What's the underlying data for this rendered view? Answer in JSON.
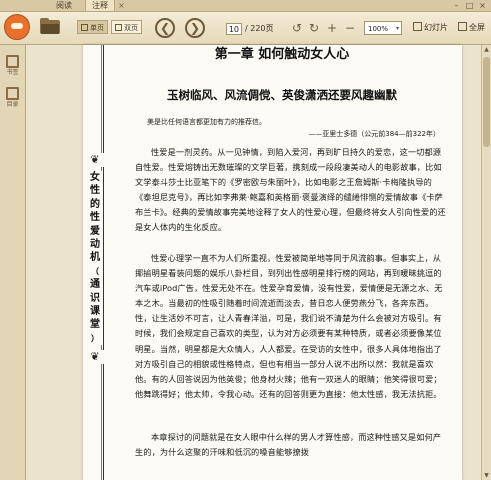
{
  "tabs": [
    {
      "label": "阅读"
    },
    {
      "label": "注释"
    }
  ],
  "tab_close": "×",
  "window_buttons": [
    "–",
    "□",
    "×"
  ],
  "toolbar": {
    "single_label": "单页",
    "double_label": "双页",
    "prev_glyph": "❮",
    "next_glyph": "❯",
    "page_current": "10",
    "page_total": "/ 220页",
    "zoom_value": "100%",
    "zoom_arrow": "▾",
    "slideshow_label": "幻灯片",
    "fullscreen_label": "全屏"
  },
  "sidebar": {
    "items": [
      {
        "label": "书签"
      },
      {
        "label": "目录"
      }
    ]
  },
  "page": {
    "vertical_title": [
      "女",
      "性",
      "的",
      "性",
      "爱",
      "动",
      "机",
      "（",
      "通",
      "识",
      "课",
      "堂",
      "）"
    ],
    "chapter_title": "第一章 如何触动女人心",
    "section_title": "玉树临风、风流倜傥、英俊潇洒还要风趣幽默",
    "quote": "美是比任何语言都更加有力的推荐信。",
    "quote_attribution": "——亚里士多德（公元前384—前322年）",
    "paragraphs": [
      "性爱是一剂灵药。从一见钟情，到陷入爱河，再到旷日持久的爱恋，这一切都源自性爱。性爱熔铸出无数璀璨的文学巨著，携刻成一段段凄美动人的电影故事，比如文学泰斗莎士比亚笔下的《罗密欧与朱丽叶》，比如电影之王詹姆斯·卡梅隆执导的《泰坦尼克号》，再比如李弗莱·鲍嘉和英格丽·褒曼演绎的缱绻悱恻的爱情故事《卡萨布兰卡》。经典的爱情故事完美地诠释了女人的性爱心理，但最终将女人引向性爱的还是女人体内的生化反应。",
      "性爱心理学一直不为人们所重视，性爱被简单地等同于风流韵事。但事实上，从揶揄明星看装问题的娱乐八卦栏目，到列出性感明星排行榜的网站，再到暖昧挑逗的汽车或iPod广告，性爱无处不在。性爱孕育爱情，没有性爱，爱情便是无源之水、无本之木。当最初的性吸引随着时间流逝而淡去，昔日恋人便劳燕分飞，各奔东西。性，让生活妙不可言，让人青春洋溢，可是，我们说不清楚为什么会被对方吸引。有时候，我们会规定自己喜欢的类型，认为对方必须要有某种特质，或者必须要像某位明星。当然，明星都是大众情人，人人都爱。在受访的女性中，很多人具体地指出了对方吸引自己的相貌或性格特点，但也有相当一部分人说不出所以然：我就是喜欢他。有的人回答说因为他英俊；他身材火辣；他有一双迷人的眼睛；他笑得很可爱；他舞跳得好；他太帅，令我心动。还有的回答则更为直接：他太性感，我无法抗拒。",
      "本章探讨的问题就是在女人眼中什么样的男人才算性感，而这种性感又是如何产生的，为什么这聚的汗味和低沉的嗓音能够撩拨"
    ]
  }
}
